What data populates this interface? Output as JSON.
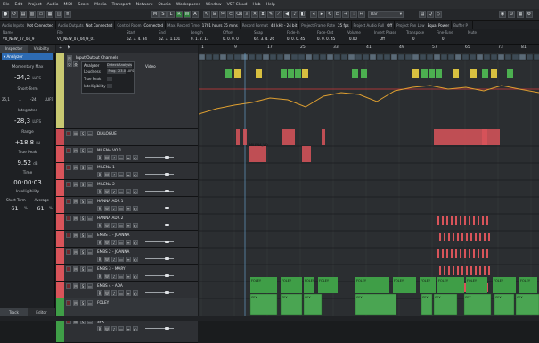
{
  "menu": [
    "File",
    "Edit",
    "Project",
    "Audio",
    "MIDI",
    "Score",
    "Media",
    "Transport",
    "Network",
    "Studio",
    "Workspaces",
    "Window",
    "VST Cloud",
    "Hub",
    "Help"
  ],
  "toolbar": {
    "mode_letters": [
      "M",
      "S",
      "L",
      "R",
      "W",
      "A"
    ],
    "preset": "Bar",
    "zoom_hint": "Q"
  },
  "infobar": [
    {
      "k": "Audio Inputs",
      "v": "Not Connected"
    },
    {
      "k": "Audio Outputs",
      "v": "Not Connected"
    },
    {
      "k": "Control Room",
      "v": "Connected"
    },
    {
      "k": "Max. Record Time",
      "v": "1701 hours 35 mins"
    },
    {
      "k": "Record Format",
      "v": "48 kHz - 24 bit"
    },
    {
      "k": "Project Frame Rate",
      "v": "25 fps"
    },
    {
      "k": "Project Audio Pull",
      "v": "Off"
    },
    {
      "k": "Project Pan Law",
      "v": "Equal Power"
    },
    {
      "k": "Buffer P",
      "v": ""
    }
  ],
  "infoline": {
    "name_label": "Name",
    "name_value": "V0_NEW_07_04_9",
    "file_label": "File",
    "file_value": "V0_NEW_07_04_9_01",
    "start_label": "Start",
    "start_value": "62. 3. 4. 34",
    "end_label": "End",
    "end_value": "62. 3. 1.101",
    "length_label": "Length",
    "length_value": "0. 1. 2. 17",
    "offset_label": "Offset",
    "offset_value": "0. 0. 0. 0",
    "snap_label": "Snap",
    "snap_value": "62. 3. 4. 26",
    "fadein_label": "Fade-In",
    "fadein_value": "0. 0. 0. 45",
    "fadeout_label": "Fade-Out",
    "fadeout_value": "0. 0. 0. 45",
    "volume_label": "Volume",
    "volume_value": "0.00",
    "invert_label": "Invert Phase",
    "invert_value": "Off",
    "transpose_label": "Transpose",
    "transpose_value": "0",
    "finetune_label": "Fine-Tune",
    "finetune_value": "0",
    "mute_label": "Mute",
    "mute_value": ""
  },
  "inspector": {
    "tabs": [
      "Inspector",
      "Visibility"
    ],
    "section": "Analyzer",
    "momentary_label": "Momentary Max",
    "momentary_value": "-24,2",
    "momentary_unit": "LUFS",
    "shortterm_label": "Short-Term",
    "shortterm_row": [
      "25,1",
      "...",
      "-24",
      "LUFS"
    ],
    "integrated_label": "Integrated",
    "integrated_value": "-28,3",
    "integrated_unit": "LUFS",
    "range_label": "Range",
    "range_value": "+18,8",
    "range_unit": "LU",
    "truepeak_label": "True Peak",
    "truepeak_value": "9.52",
    "truepeak_unit": "dB",
    "time_label": "Time",
    "time_value": "00:00:03",
    "intelligibility_label": "Intelligibility",
    "intel_cols": [
      "Short Term",
      "Average"
    ],
    "intel_vals": [
      "61",
      "61"
    ],
    "intel_unit": "%",
    "bottom_tabs": [
      "Track",
      "Editor"
    ]
  },
  "tracklist": {
    "folder_header": "Input/Output Channels",
    "video_track": "Video",
    "analyzer_panel": [
      "Analyzer",
      "Loudness",
      "True Peak",
      "Intelligibility"
    ],
    "analyzer_btns": [
      "Detect Analysis",
      "Prog.",
      "23.0",
      "LUFS"
    ],
    "tracks": [
      {
        "name": "DIALOGUE",
        "color": "#c94a52",
        "folder": true
      },
      {
        "name": "MILENA VO 1",
        "color": "#d9545a"
      },
      {
        "name": "MILENA 1",
        "color": "#d9545a"
      },
      {
        "name": "MILENA 2",
        "color": "#d9545a"
      },
      {
        "name": "HANNA ADR 1",
        "color": "#d9545a"
      },
      {
        "name": "HANNA ADR 2",
        "color": "#d9545a"
      },
      {
        "name": "EMBS 1 - JOANNA",
        "color": "#d9545a"
      },
      {
        "name": "EMBS 2 - JOANNA",
        "color": "#d9545a"
      },
      {
        "name": "EMBS 3 - MARY",
        "color": "#d9545a"
      },
      {
        "name": "EMBS 4 - ADA",
        "color": "#d9545a"
      },
      {
        "name": "FOLEY",
        "color": "#3f9e47",
        "folder": true
      },
      {
        "name": "SFX",
        "color": "#3f9e47"
      }
    ]
  },
  "ruler": [
    "1",
    "9",
    "17",
    "25",
    "33",
    "41",
    "49",
    "57",
    "65",
    "73",
    "81"
  ],
  "clips": {
    "milena_vo": "MILENA_VO",
    "foley": "FOLEY",
    "sfx": "SFX"
  },
  "colors": {
    "accent_blue": "#2d6bb3",
    "dialogue_red": "#d9545a",
    "foley_green": "#3f9e47",
    "video_yellow": "#c8c871",
    "loudness_curve": "#e0a030",
    "target_line": "#d23a3a"
  }
}
